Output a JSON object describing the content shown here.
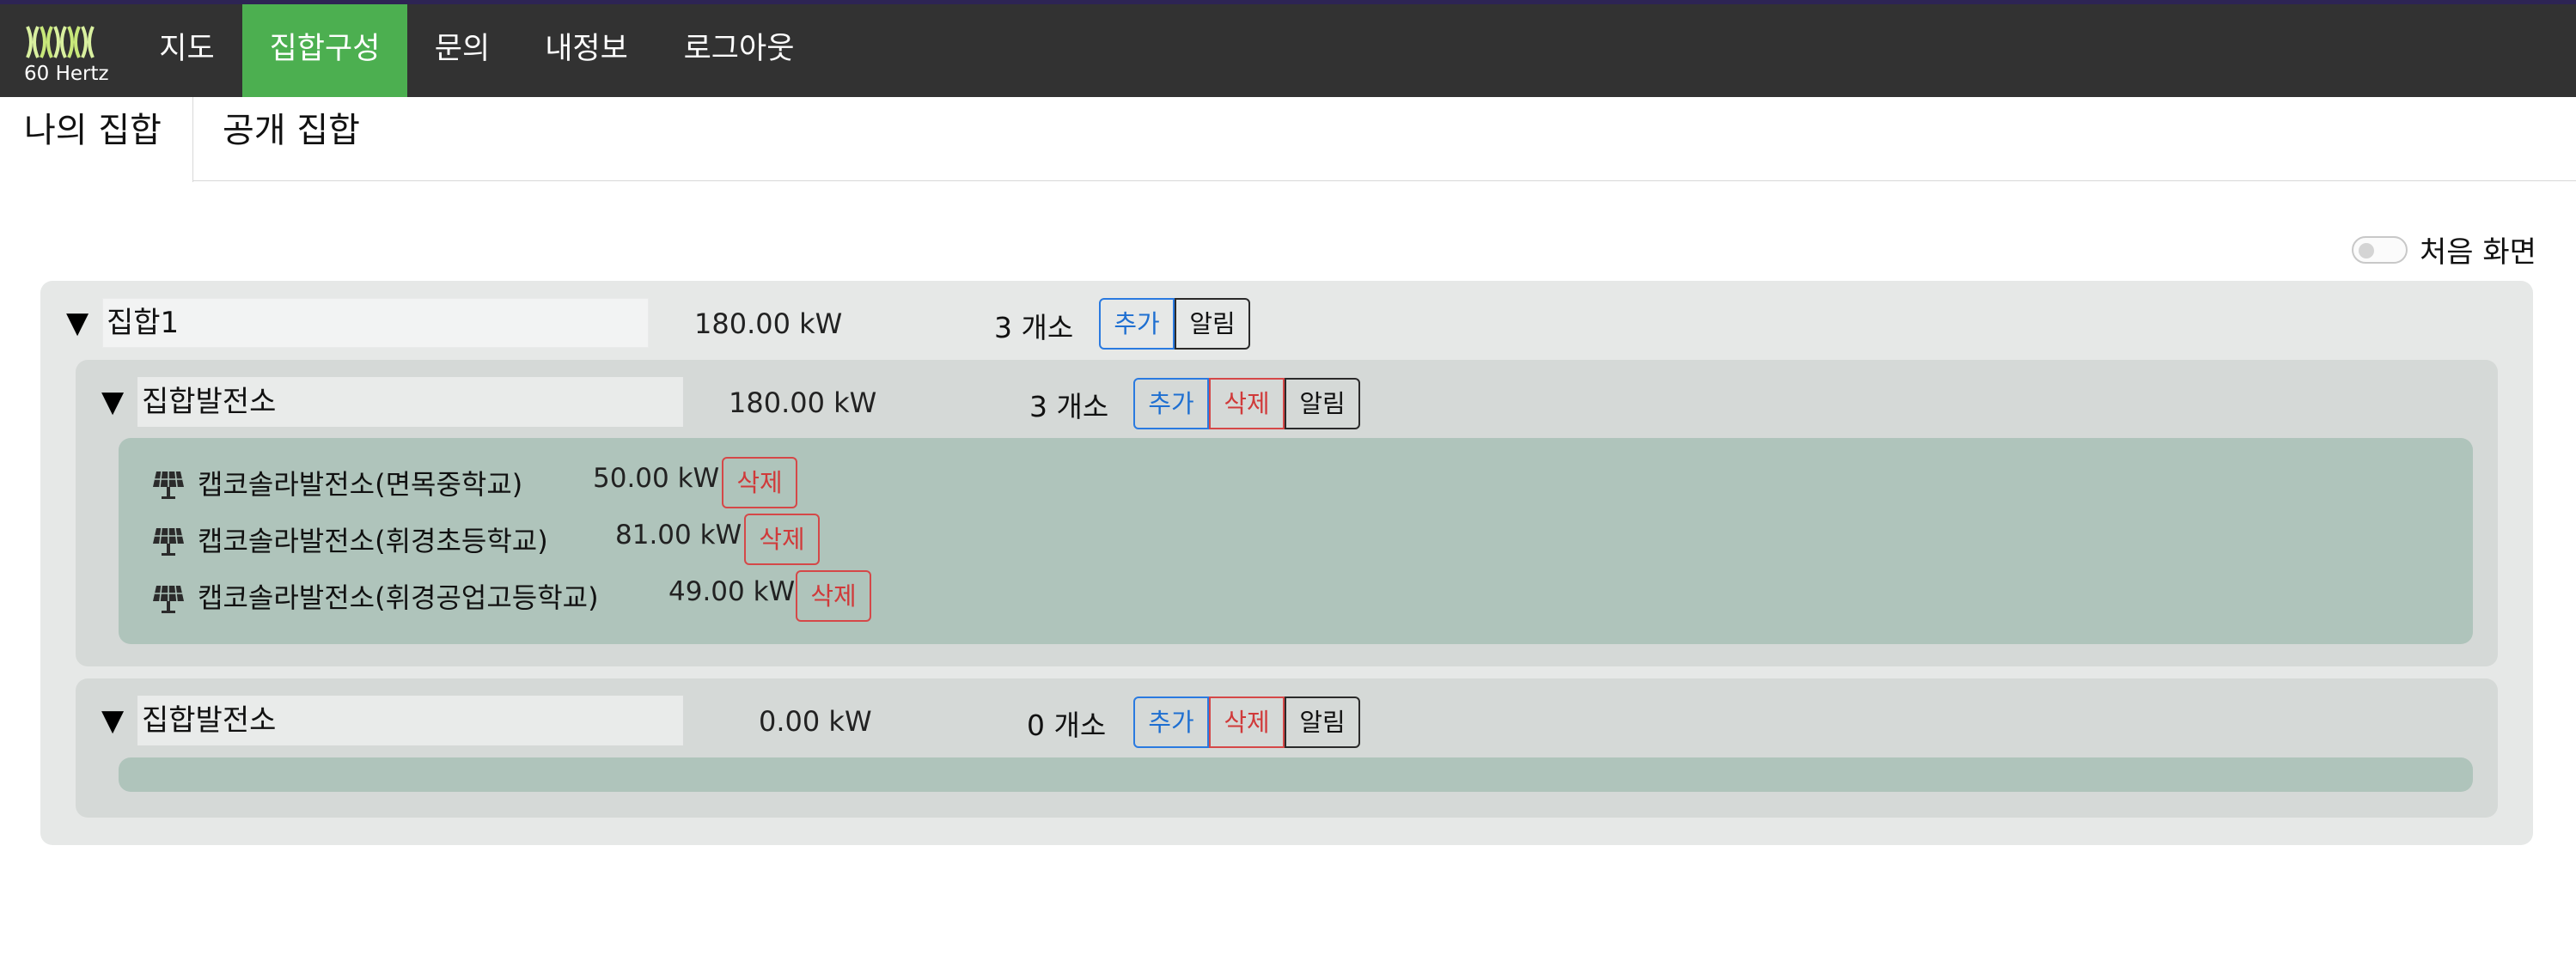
{
  "header": {
    "logo_text": "60 Hertz",
    "nav": [
      {
        "label": "지도"
      },
      {
        "label": "집합구성"
      },
      {
        "label": "문의"
      },
      {
        "label": "내정보"
      },
      {
        "label": "로그아웃"
      }
    ],
    "active_nav": "집합구성",
    "colors": {
      "bar": "#323232",
      "active": "#4caf50"
    }
  },
  "tabs": [
    {
      "label": "나의 집합"
    },
    {
      "label": "공개 집합"
    }
  ],
  "active_tab": "나의 집합",
  "home_toggle": {
    "label": "처음 화면",
    "on": false
  },
  "group": {
    "name": "집합1",
    "capacity": "180.00 kW",
    "count": "3 개소",
    "buttons": {
      "add": "추가",
      "notify": "알림"
    },
    "subgroups": [
      {
        "name": "집합발전소",
        "capacity": "180.00 kW",
        "count": "3 개소",
        "buttons": {
          "add": "추가",
          "delete": "삭제",
          "notify": "알림"
        },
        "plants": [
          {
            "name": "캡코솔라발전소(면목중학교)",
            "capacity": "50.00 kW",
            "delete": "삭제",
            "icon": "solar-panel-icon"
          },
          {
            "name": "캡코솔라발전소(휘경초등학교)",
            "capacity": "81.00 kW",
            "delete": "삭제",
            "icon": "solar-panel-icon"
          },
          {
            "name": "캡코솔라발전소(휘경공업고등학교)",
            "capacity": "49.00 kW",
            "delete": "삭제",
            "icon": "solar-panel-icon"
          }
        ]
      },
      {
        "name": "집합발전소",
        "capacity": "0.00 kW",
        "count": "0 개소",
        "buttons": {
          "add": "추가",
          "delete": "삭제",
          "notify": "알림"
        },
        "plants": []
      }
    ]
  },
  "caret_symbol": "▼",
  "colors": {
    "group_bg": "#e6e8e7",
    "subgroup_bg": "#d5d9d7",
    "plants_bg": "#afc4bb",
    "add": "#1e6fd1",
    "delete": "#d03a3a"
  }
}
